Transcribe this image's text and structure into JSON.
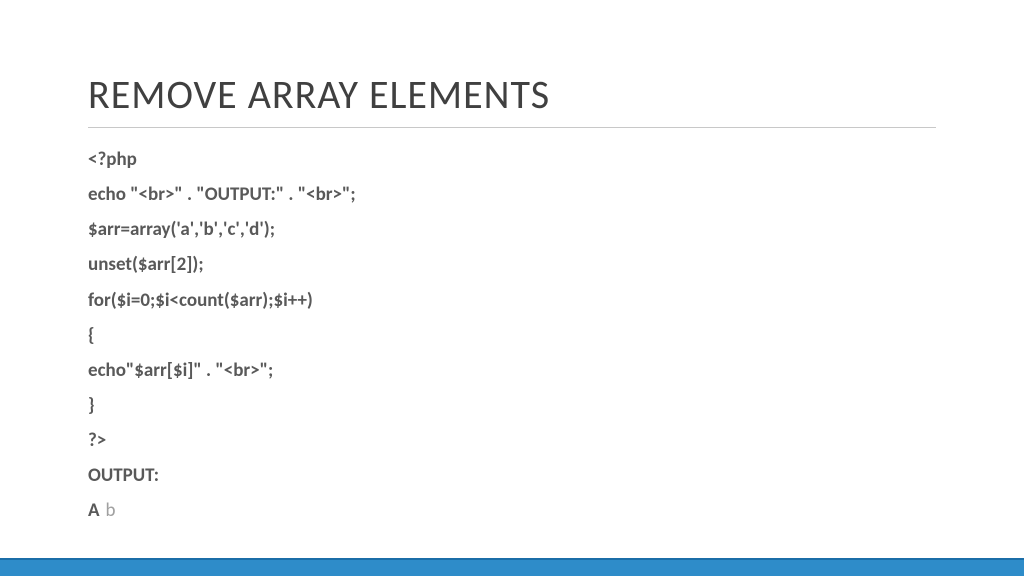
{
  "title": "REMOVE ARRAY ELEMENTS",
  "code": {
    "l1": "<?php",
    "l2": "echo \"<br>\" . \"OUTPUT:\" . \"<br>\";",
    "l3": "$arr=array('a','b','c','d');",
    "l4": "unset($arr[2]);",
    "l5": "for($i=0;$i<count($arr);$i++)",
    "l6": "{",
    "l7": "echo\"$arr[$i]\" . \"<br>\";",
    "l8": "}",
    "l9": "?>"
  },
  "output": {
    "label": "OUTPUT:",
    "a": "A",
    "b": "b"
  }
}
